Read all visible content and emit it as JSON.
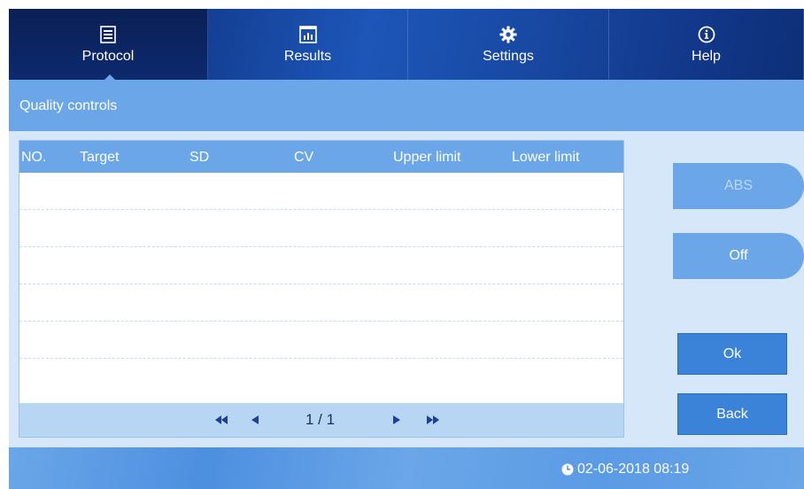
{
  "nav": {
    "tabs": [
      {
        "label": "Protocol",
        "icon": "protocol-icon",
        "active": true
      },
      {
        "label": "Results",
        "icon": "results-icon",
        "active": false
      },
      {
        "label": "Settings",
        "icon": "gear-icon",
        "active": false
      },
      {
        "label": "Help",
        "icon": "info-icon",
        "active": false
      }
    ]
  },
  "section": {
    "title": "Quality controls"
  },
  "table": {
    "columns": [
      "NO.",
      "Target",
      "SD",
      "CV",
      "Upper limit",
      "Lower limit"
    ],
    "rows": []
  },
  "pager": {
    "page_text": "1 / 1"
  },
  "side_buttons": {
    "abs": "ABS",
    "off": "Off",
    "ok": "Ok",
    "back": "Back"
  },
  "footer": {
    "datetime": "02-06-2018 08:19"
  },
  "colors": {
    "nav_dark": "#0b2a6b",
    "section_blue": "#6aa6e8",
    "panel_bg": "#d6e7f9",
    "button_blue": "#3b83d9"
  }
}
